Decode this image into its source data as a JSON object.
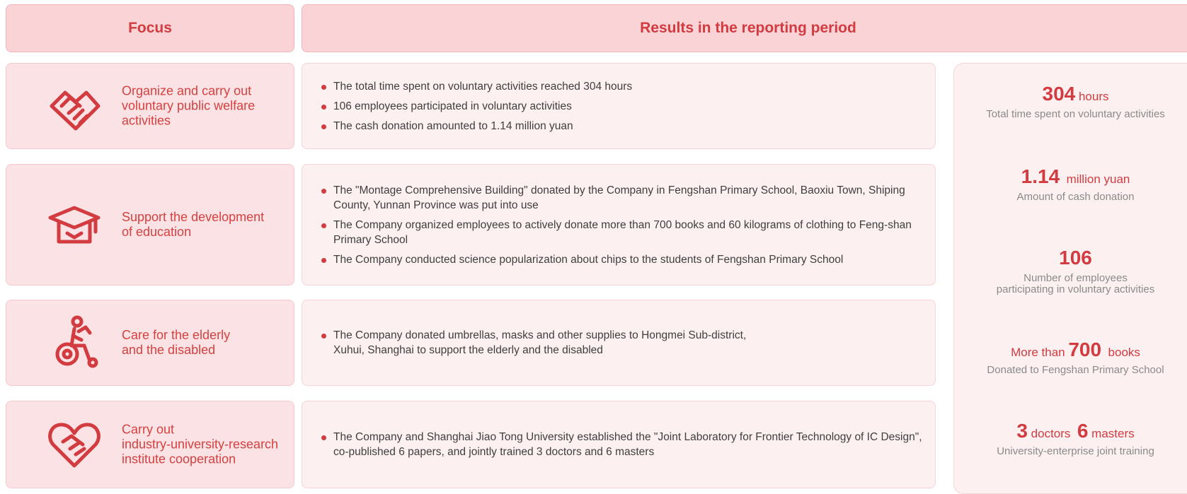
{
  "header": {
    "focus": "Focus",
    "results": "Results in the reporting period"
  },
  "rows": [
    {
      "icon": "handshake-icon",
      "focus": "Organize and carry out\nvoluntary public welfare\nactivities",
      "items": [
        "The total time spent on voluntary activities reached 304 hours",
        "106 employees participated in voluntary activities",
        "The cash donation amounted to 1.14 million yuan"
      ]
    },
    {
      "icon": "graduation-cap-icon",
      "focus": "Support the development\nof education",
      "items": [
        "The \"Montage Comprehensive Building\" donated by the Company in Fengshan Primary School, Baoxiu Town, Shiping County, Yunnan Province was put into use",
        "The Company organized employees to actively donate more than 700 books and 60 kilograms of clothing to Feng-shan Primary School",
        "The Company conducted science popularization about chips to the students of Fengshan Primary School"
      ]
    },
    {
      "icon": "wheelchair-icon",
      "focus": "Care for the elderly\nand the disabled",
      "items": [
        "The Company donated umbrellas, masks and other supplies to Hongmei Sub-district,\nXuhui, Shanghai to support the elderly and the disabled"
      ]
    },
    {
      "icon": "heart-handshake-icon",
      "focus": "Carry out\nindustry-university-research\ninstitute cooperation",
      "items": [
        "The Company and Shanghai Jiao Tong University established the \"Joint Laboratory for Frontier Technology of IC Design\", co-published 6 papers, and jointly trained 3 doctors and 6 masters"
      ]
    }
  ],
  "stats": [
    {
      "prefix": "",
      "value": "304",
      "unit": "hours",
      "value2": "",
      "unit2": "",
      "caption": "Total time spent on voluntary activities"
    },
    {
      "prefix": "",
      "value": "1.14",
      "unit": "million yuan",
      "value2": "",
      "unit2": "",
      "caption": "Amount of cash donation"
    },
    {
      "prefix": "",
      "value": "106",
      "unit": "",
      "value2": "",
      "unit2": "",
      "caption": "Number of employees\nparticipating in voluntary activities"
    },
    {
      "prefix": "More than",
      "value": "700",
      "unit": "books",
      "value2": "",
      "unit2": "",
      "caption": "Donated to Fengshan Primary School"
    },
    {
      "prefix": "",
      "value": "3",
      "unit": "doctors",
      "value2": "6",
      "unit2": "masters",
      "caption": "University-enterprise joint training"
    }
  ],
  "colors": {
    "accent": "#d23b3f",
    "header_bg": "#f9d3d6",
    "focus_bg": "#fbe3e5",
    "result_bg": "#fdf0f1"
  }
}
